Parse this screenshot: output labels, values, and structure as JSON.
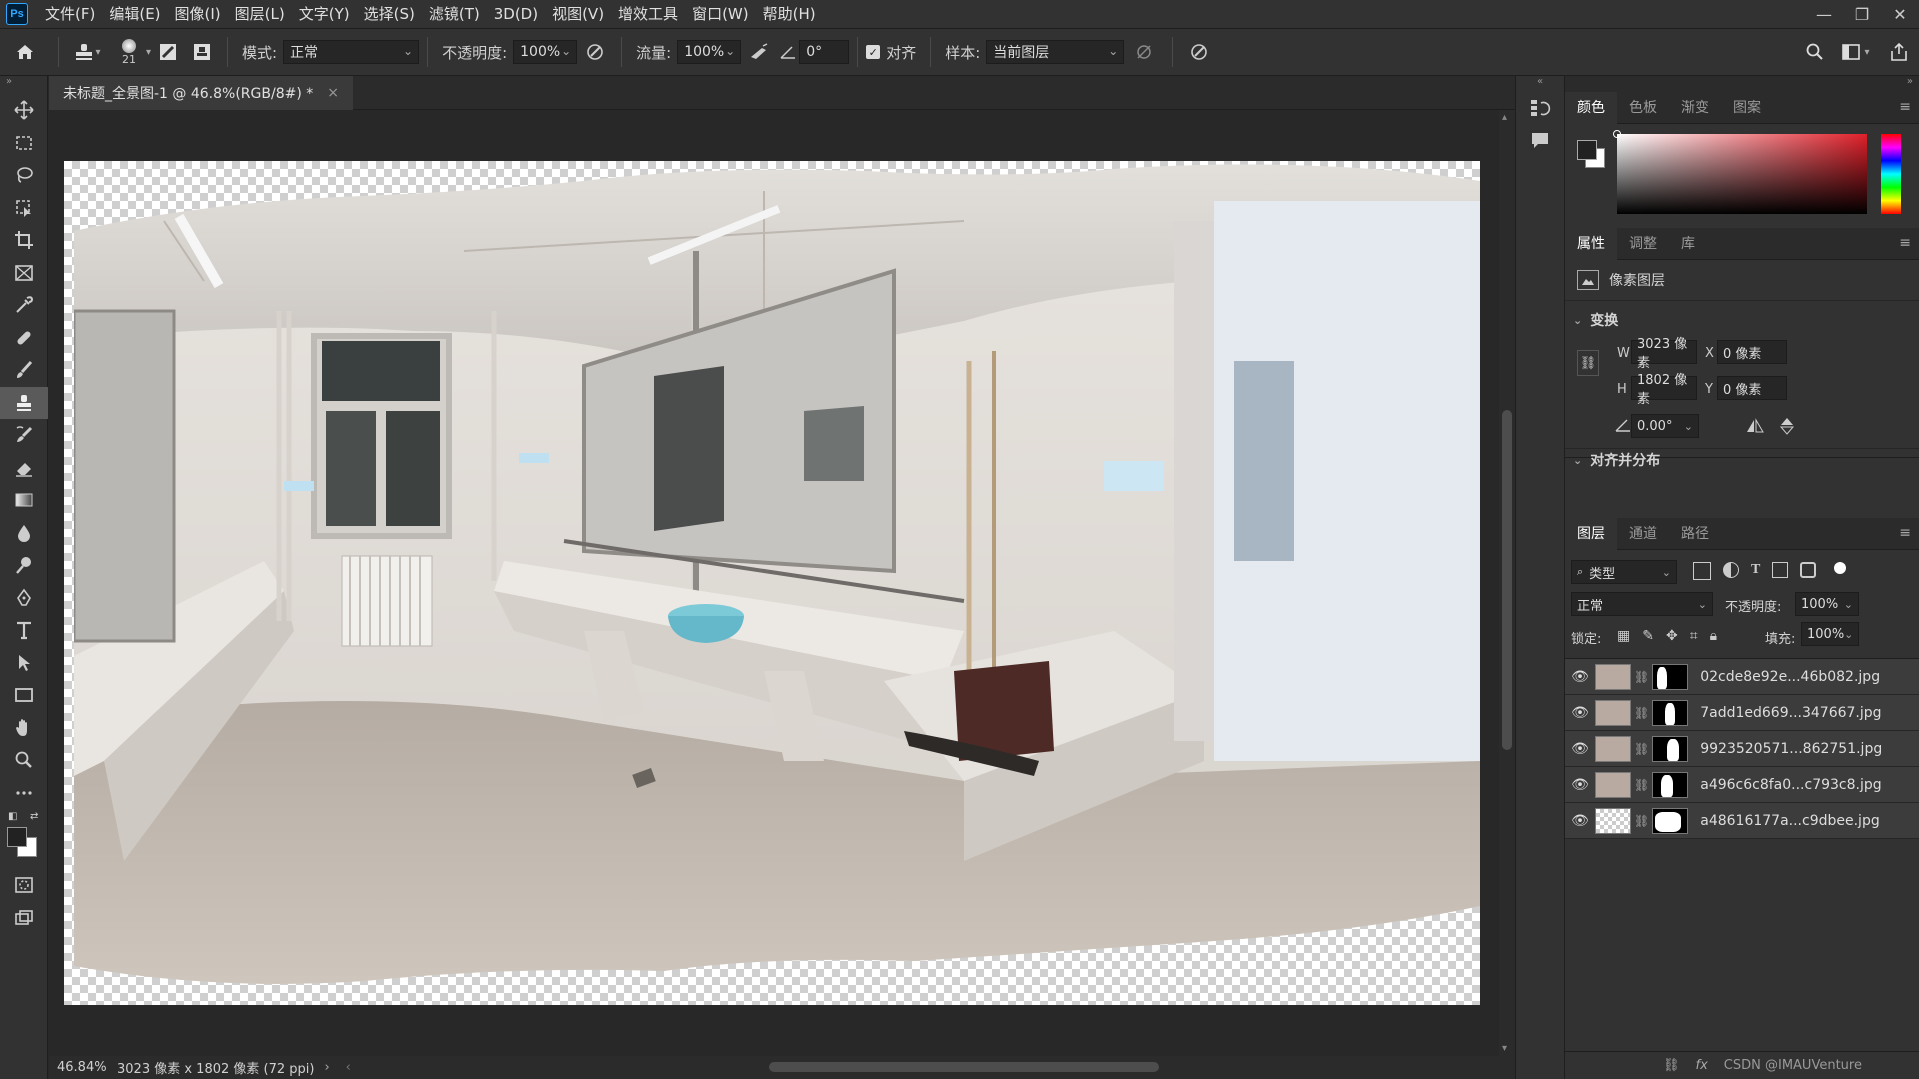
{
  "app": {
    "logo": "Ps"
  },
  "menu": [
    "文件(F)",
    "编辑(E)",
    "图像(I)",
    "图层(L)",
    "文字(Y)",
    "选择(S)",
    "滤镜(T)",
    "3D(D)",
    "视图(V)",
    "增效工具",
    "窗口(W)",
    "帮助(H)"
  ],
  "window_controls": {
    "minimize": "—",
    "restore": "❐",
    "close": "✕"
  },
  "options": {
    "brush_size": "21",
    "mode_label": "模式:",
    "mode_value": "正常",
    "opacity_label": "不透明度:",
    "opacity_value": "100%",
    "flow_label": "流量:",
    "flow_value": "100%",
    "angle_value": "0°",
    "align_label": "对齐",
    "align_checked": true,
    "sample_label": "样本:",
    "sample_value": "当前图层"
  },
  "document": {
    "tab_title": "未标题_全景图-1 @ 46.8%(RGB/8#) *",
    "tab_close": "×"
  },
  "status": {
    "zoom": "46.84%",
    "info": "3023 像素 x 1802 像素 (72 ppi)"
  },
  "color_panel": {
    "tabs": [
      "颜色",
      "色板",
      "渐变",
      "图案"
    ],
    "active": 0
  },
  "props_panel": {
    "tabs": [
      "属性",
      "调整",
      "库"
    ],
    "active": 0,
    "layer_type": "像素图层",
    "transform_label": "变换",
    "w_label": "W",
    "w_value": "3023 像素",
    "h_label": "H",
    "h_value": "1802 像素",
    "x_label": "X",
    "x_value": "0 像素",
    "y_label": "Y",
    "y_value": "0 像素",
    "angle_value": "0.00°",
    "align_label": "对齐并分布"
  },
  "layers_panel": {
    "tabs": [
      "图层",
      "通道",
      "路径"
    ],
    "active": 0,
    "filter_value": "类型",
    "blend_value": "正常",
    "opacity_label": "不透明度:",
    "opacity_value": "100%",
    "lock_label": "锁定:",
    "fill_label": "填充:",
    "fill_value": "100%",
    "layers": [
      {
        "name": "02cde8e92e...46b082.jpg"
      },
      {
        "name": "7add1ed669...347667.jpg"
      },
      {
        "name": "9923520571...862751.jpg"
      },
      {
        "name": "a496c6c8fa0...c793c8.jpg"
      },
      {
        "name": "a48616177a...c9dbee.jpg"
      }
    ]
  },
  "watermark": "CSDN @IMAUVenture"
}
